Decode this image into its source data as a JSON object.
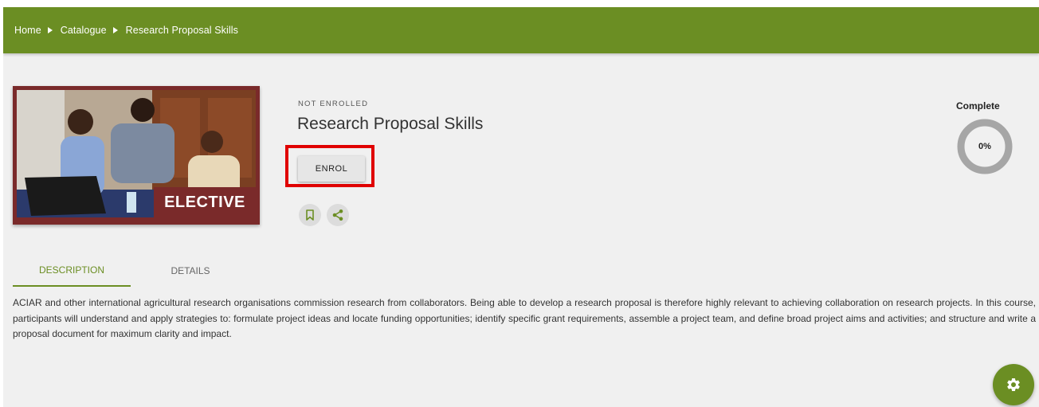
{
  "breadcrumb": {
    "items": [
      "Home",
      "Catalogue",
      "Research Proposal Skills"
    ]
  },
  "course": {
    "image_tag": "ELECTIVE",
    "status": "NOT ENROLLED",
    "title": "Research Proposal Skills",
    "enrol_label": "ENROL",
    "bookmark_icon": "bookmark-icon",
    "share_icon": "share-icon"
  },
  "progress": {
    "label": "Complete",
    "value_text": "0%",
    "value": 0
  },
  "tabs": [
    {
      "label": "DESCRIPTION",
      "active": true
    },
    {
      "label": "DETAILS",
      "active": false
    }
  ],
  "description": "ACIAR and other international agricultural research organisations commission research from collaborators. Being able to develop a research proposal is therefore highly relevant to achieving collaboration on research projects. In this course, participants will understand and apply strategies to: formulate project ideas and locate funding opportunities; identify specific grant requirements, assemble a project team, and define broad project aims and activities; and structure and write a proposal document for maximum clarity and impact.",
  "fab_icon": "gear-icon",
  "colors": {
    "brand": "#6b8e23",
    "tag": "#7a2a2a",
    "highlight": "#e00000"
  }
}
